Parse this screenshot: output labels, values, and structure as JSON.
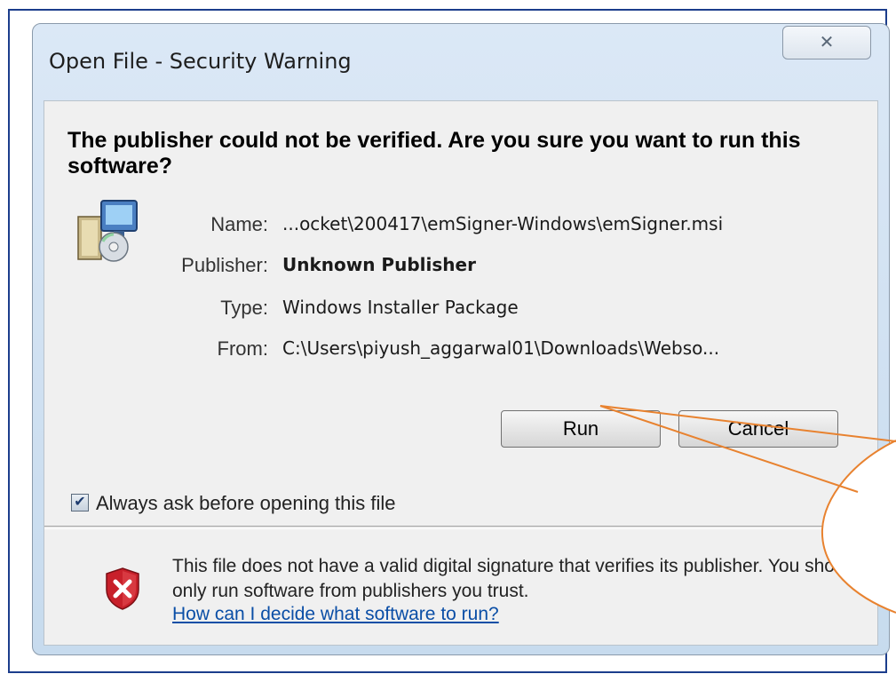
{
  "dialog": {
    "title": "Open File - Security Warning",
    "close_glyph": "✕",
    "headline": "The publisher could not be verified.  Are you sure you want to run this software?",
    "icon": "installer-package-icon",
    "details": [
      {
        "label": "Name:",
        "value": "...ocket\\200417\\emSigner-Windows\\emSigner.msi",
        "bold": false
      },
      {
        "label": "Publisher:",
        "value": "Unknown Publisher",
        "bold": true
      },
      {
        "label": "Type:",
        "value": "Windows Installer Package",
        "bold": false
      },
      {
        "label": "From:",
        "value": "C:\\Users\\piyush_aggarwal01\\Downloads\\Webso...",
        "bold": false
      }
    ],
    "buttons": {
      "run": "Run",
      "cancel": "Cancel"
    },
    "checkbox": {
      "label": "Always ask before opening this file",
      "checked": true,
      "check_glyph": "✔"
    },
    "warning": {
      "icon": "red-shield-x-icon",
      "text": "This file does not have a valid digital signature that verifies its publisher.  You should only run software from publishers you trust.",
      "link": "How can I decide what software to run?"
    }
  },
  "colors": {
    "frame_border": "#1c3d8c",
    "callout": "#e8822f",
    "link": "#0a4ea6"
  }
}
